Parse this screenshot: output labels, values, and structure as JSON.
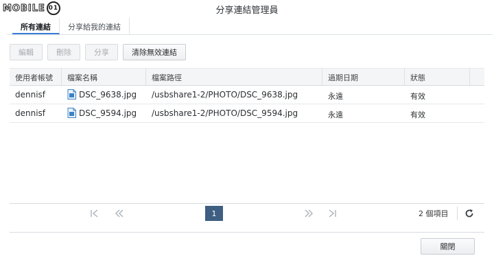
{
  "watermark": {
    "text": "MOBILE",
    "badge": "01"
  },
  "window": {
    "title": "分享連結管理員"
  },
  "tabs": [
    {
      "label": "所有連結",
      "active": true
    },
    {
      "label": "分享給我的連結",
      "active": false
    }
  ],
  "toolbar": {
    "edit_label": "編輯",
    "delete_label": "刪除",
    "share_label": "分享",
    "clear_label": "清除無效連結"
  },
  "table": {
    "columns": [
      "使用者帳號",
      "檔案名稱",
      "檔案路徑",
      "過期日期",
      "狀態"
    ],
    "rows": [
      {
        "user": "dennisf",
        "file": "DSC_9638.jpg",
        "path": "/usbshare1-2/PHOTO/DSC_9638.jpg",
        "expires": "永遠",
        "status": "有效"
      },
      {
        "user": "dennisf",
        "file": "DSC_9594.jpg",
        "path": "/usbshare1-2/PHOTO/DSC_9594.jpg",
        "expires": "永遠",
        "status": "有效"
      }
    ]
  },
  "pager": {
    "current_page": "1",
    "item_count": "2 個項目"
  },
  "footer": {
    "close_label": "關閉"
  },
  "colors": {
    "accent": "#3a7bd5",
    "page_active": "#3e5f82",
    "file_icon": "#3b82c4"
  },
  "icons": [
    "first-page-icon",
    "prev-page-icon",
    "next-page-icon",
    "last-page-icon",
    "refresh-icon",
    "image-file-icon"
  ]
}
